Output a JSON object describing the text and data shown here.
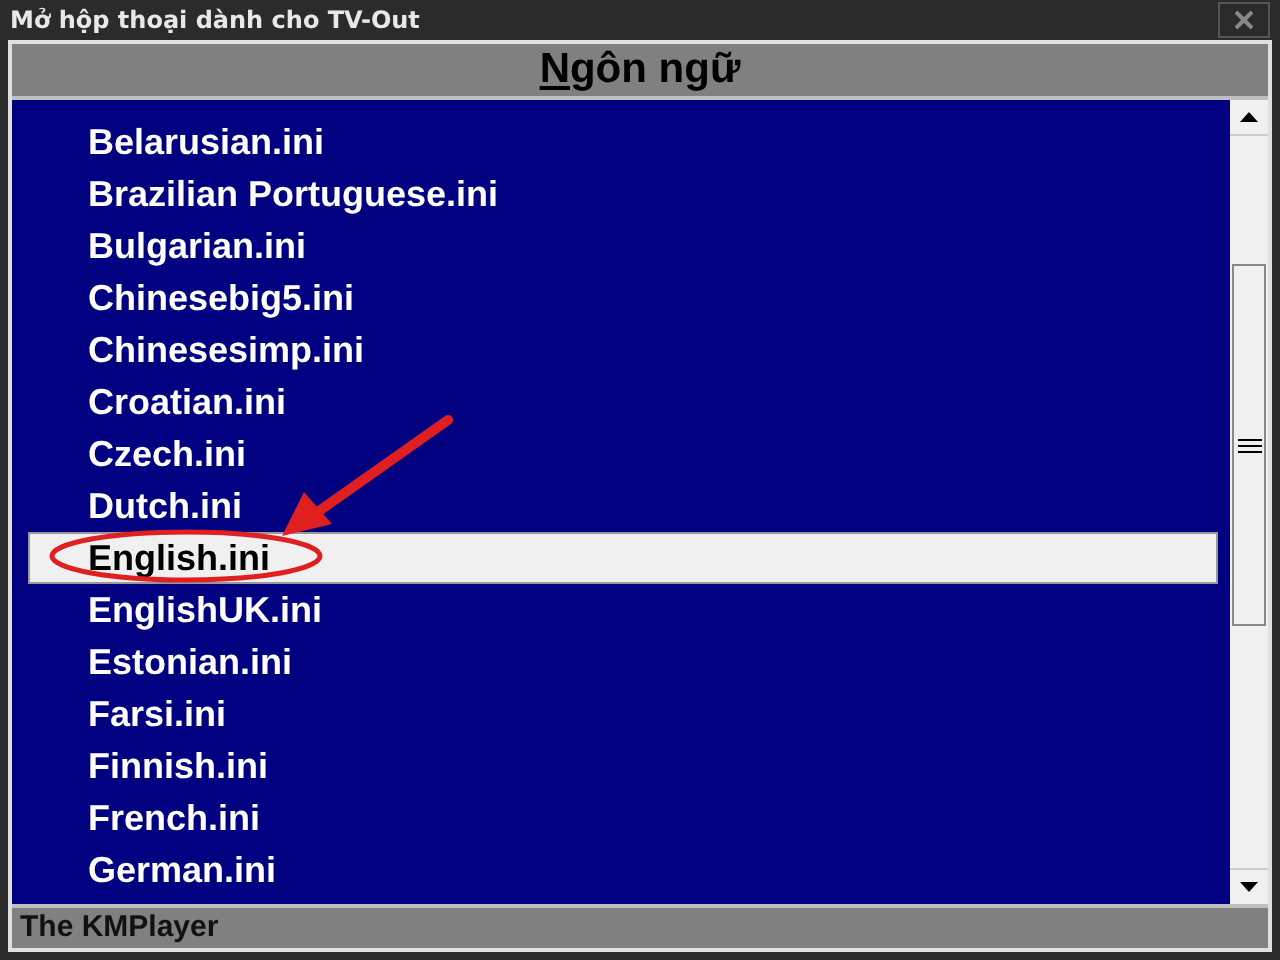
{
  "window": {
    "title": "Mở hộp thoại dành cho TV-Out"
  },
  "heading": {
    "text": "Ngôn ngữ",
    "underline_first": true
  },
  "list": {
    "items": [
      {
        "label": "Belarusian.ini",
        "selected": false
      },
      {
        "label": "Brazilian Portuguese.ini",
        "selected": false
      },
      {
        "label": "Bulgarian.ini",
        "selected": false
      },
      {
        "label": "Chinesebig5.ini",
        "selected": false
      },
      {
        "label": "Chinesesimp.ini",
        "selected": false
      },
      {
        "label": "Croatian.ini",
        "selected": false
      },
      {
        "label": "Czech.ini",
        "selected": false
      },
      {
        "label": "Dutch.ini",
        "selected": false
      },
      {
        "label": "English.ini",
        "selected": true
      },
      {
        "label": "EnglishUK.ini",
        "selected": false
      },
      {
        "label": "Estonian.ini",
        "selected": false
      },
      {
        "label": "Farsi.ini",
        "selected": false
      },
      {
        "label": "Finnish.ini",
        "selected": false
      },
      {
        "label": "French.ini",
        "selected": false
      },
      {
        "label": "German.ini",
        "selected": false
      }
    ]
  },
  "status_bar": {
    "text": "The KMPlayer"
  }
}
